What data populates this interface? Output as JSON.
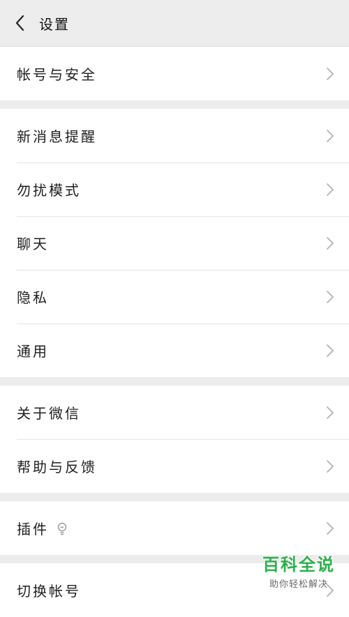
{
  "header": {
    "title": "设置",
    "back_icon": "chevron-left-icon"
  },
  "groups": [
    {
      "items": [
        {
          "label": "帐号与安全"
        }
      ]
    },
    {
      "items": [
        {
          "label": "新消息提醒"
        },
        {
          "label": "勿扰模式"
        },
        {
          "label": "聊天"
        },
        {
          "label": "隐私"
        },
        {
          "label": "通用"
        }
      ]
    },
    {
      "items": [
        {
          "label": "关于微信"
        },
        {
          "label": "帮助与反馈"
        }
      ]
    },
    {
      "items": [
        {
          "label": "插件",
          "icon": "bulb-icon"
        }
      ]
    },
    {
      "items": [
        {
          "label": "切换帐号"
        }
      ]
    }
  ],
  "watermark": {
    "title": "百科全说",
    "subtitle": "助你轻松解决",
    "color": "#2bb04a"
  },
  "colors": {
    "background": "#ececec",
    "header": "#ededed",
    "row": "#ffffff",
    "divider": "#e3e3e3"
  }
}
